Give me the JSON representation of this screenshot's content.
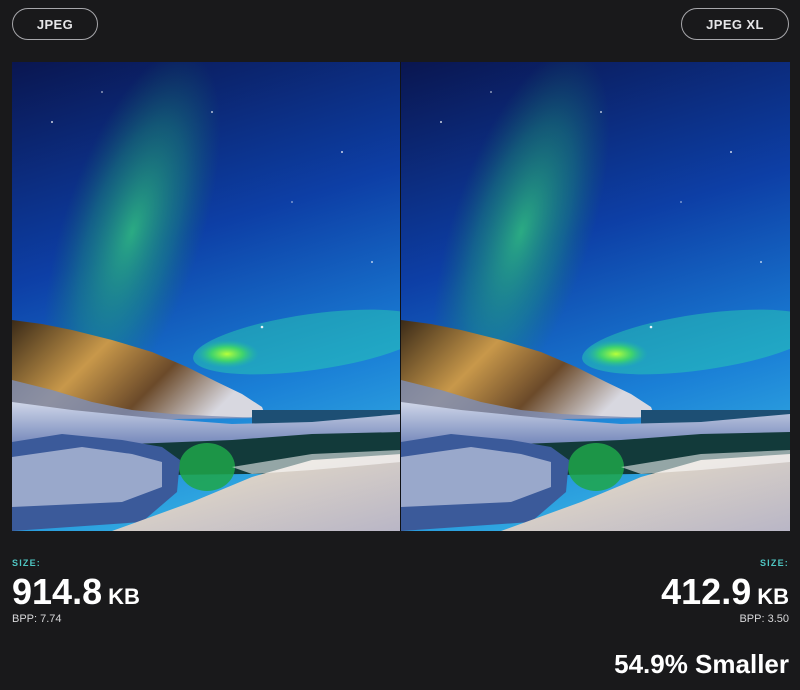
{
  "comparison": {
    "left": {
      "format_label": "JPEG",
      "size_label": "SIZE:",
      "size_value": "914.8",
      "size_unit": "KB",
      "bpp": "BPP: 7.74"
    },
    "right": {
      "format_label": "JPEG XL",
      "size_label": "SIZE:",
      "size_value": "412.9",
      "size_unit": "KB",
      "bpp": "BPP: 3.50"
    },
    "savings_text": "54.9% Smaller"
  },
  "colors": {
    "background": "#19191b",
    "accent": "#4fc6c3",
    "pill_border": "#a7a7ab",
    "text": "#ffffff"
  }
}
